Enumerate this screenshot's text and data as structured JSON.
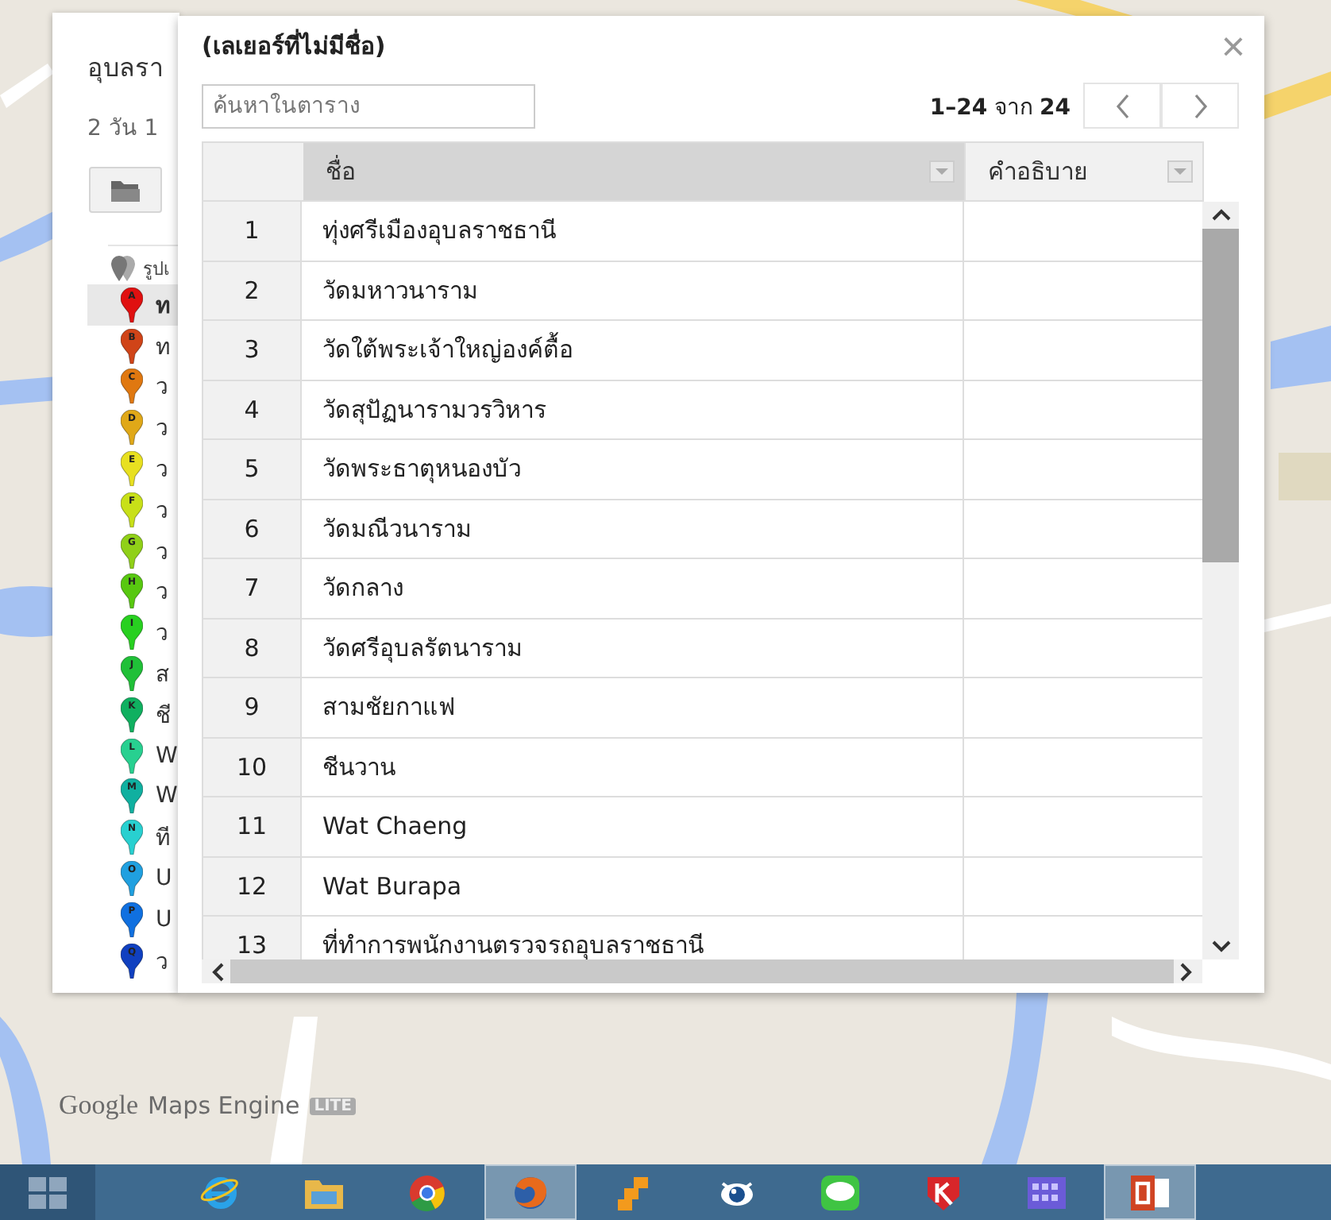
{
  "layer_panel": {
    "title": "อุบลรา",
    "subtitle": "2 วัน 1",
    "group_label": "รูปเ",
    "items": [
      {
        "marker": "A",
        "text": "ท",
        "color": "#e01010",
        "selected": true
      },
      {
        "marker": "B",
        "text": "ท",
        "color": "#d04418",
        "selected": false
      },
      {
        "marker": "C",
        "text": "ว",
        "color": "#e07810",
        "selected": false
      },
      {
        "marker": "D",
        "text": "ว",
        "color": "#e0a818",
        "selected": false
      },
      {
        "marker": "E",
        "text": "ว",
        "color": "#e8e020",
        "selected": false
      },
      {
        "marker": "F",
        "text": "ว",
        "color": "#c8e018",
        "selected": false
      },
      {
        "marker": "G",
        "text": "ว",
        "color": "#90d018",
        "selected": false
      },
      {
        "marker": "H",
        "text": "ว",
        "color": "#58c810",
        "selected": false
      },
      {
        "marker": "I",
        "text": "ว",
        "color": "#28d020",
        "selected": false
      },
      {
        "marker": "J",
        "text": "ส",
        "color": "#20c038",
        "selected": false
      },
      {
        "marker": "K",
        "text": "ชี",
        "color": "#10b060",
        "selected": false
      },
      {
        "marker": "L",
        "text": "W",
        "color": "#28d090",
        "selected": false
      },
      {
        "marker": "M",
        "text": "W",
        "color": "#10b0a0",
        "selected": false
      },
      {
        "marker": "N",
        "text": "ที",
        "color": "#28d0d0",
        "selected": false
      },
      {
        "marker": "O",
        "text": "U",
        "color": "#20a0e0",
        "selected": false
      },
      {
        "marker": "P",
        "text": "U",
        "color": "#1070e0",
        "selected": false
      },
      {
        "marker": "Q",
        "text": "ว",
        "color": "#1040c0",
        "selected": false
      }
    ]
  },
  "dialog": {
    "title": "(เลเยอร์ที่ไม่มีชื่อ)",
    "close": "×",
    "search": {
      "placeholder": "ค้นหาในตาราง"
    },
    "pagination": "**1–24** จาก **24**",
    "table": {
      "columns": [
        {
          "label": "ชื่อ",
          "selected": true
        },
        {
          "label": "คำอธิบาย",
          "selected": false
        }
      ],
      "rows": [
        {
          "index": "1",
          "name": "ทุ่งศรีเมืองอุบลราชธานี"
        },
        {
          "index": "2",
          "name": "วัดมหาวนาราม"
        },
        {
          "index": "3",
          "name": "วัดใต้พระเจ้าใหญ่องค์ตื้อ"
        },
        {
          "index": "4",
          "name": "วัดสุปัฏนารามวรวิหาร"
        },
        {
          "index": "5",
          "name": "วัดพระธาตุหนองบัว"
        },
        {
          "index": "6",
          "name": "วัดมณีวนาราม"
        },
        {
          "index": "7",
          "name": "วัดกลาง"
        },
        {
          "index": "8",
          "name": "วัดศรีอุบลรัตนาราม"
        },
        {
          "index": "9",
          "name": "สามชัยกาแฟ"
        },
        {
          "index": "10",
          "name": "ชีนวาน"
        },
        {
          "index": "11",
          "name": "Wat Chaeng"
        },
        {
          "index": "12",
          "name": "Wat Burapa"
        },
        {
          "index": "13",
          "name": "ที่ทำการพนักงานตรวจรถอุบลราชธานี"
        }
      ]
    }
  },
  "maps_logo": {
    "google": "Google",
    "product": "Maps Engine",
    "badge": "LITE"
  },
  "taskbar": {
    "apps": [
      {
        "kind": "ie",
        "selected": false
      },
      {
        "kind": "folder",
        "selected": false
      },
      {
        "kind": "chrome",
        "selected": false
      },
      {
        "kind": "firefox",
        "selected": true
      },
      {
        "kind": "blocks",
        "selected": false
      },
      {
        "kind": "eye",
        "selected": false
      },
      {
        "kind": "chat",
        "selected": false
      },
      {
        "kind": "shield",
        "selected": false
      },
      {
        "kind": "grid",
        "selected": false
      },
      {
        "kind": "slides",
        "selected": true
      }
    ]
  }
}
